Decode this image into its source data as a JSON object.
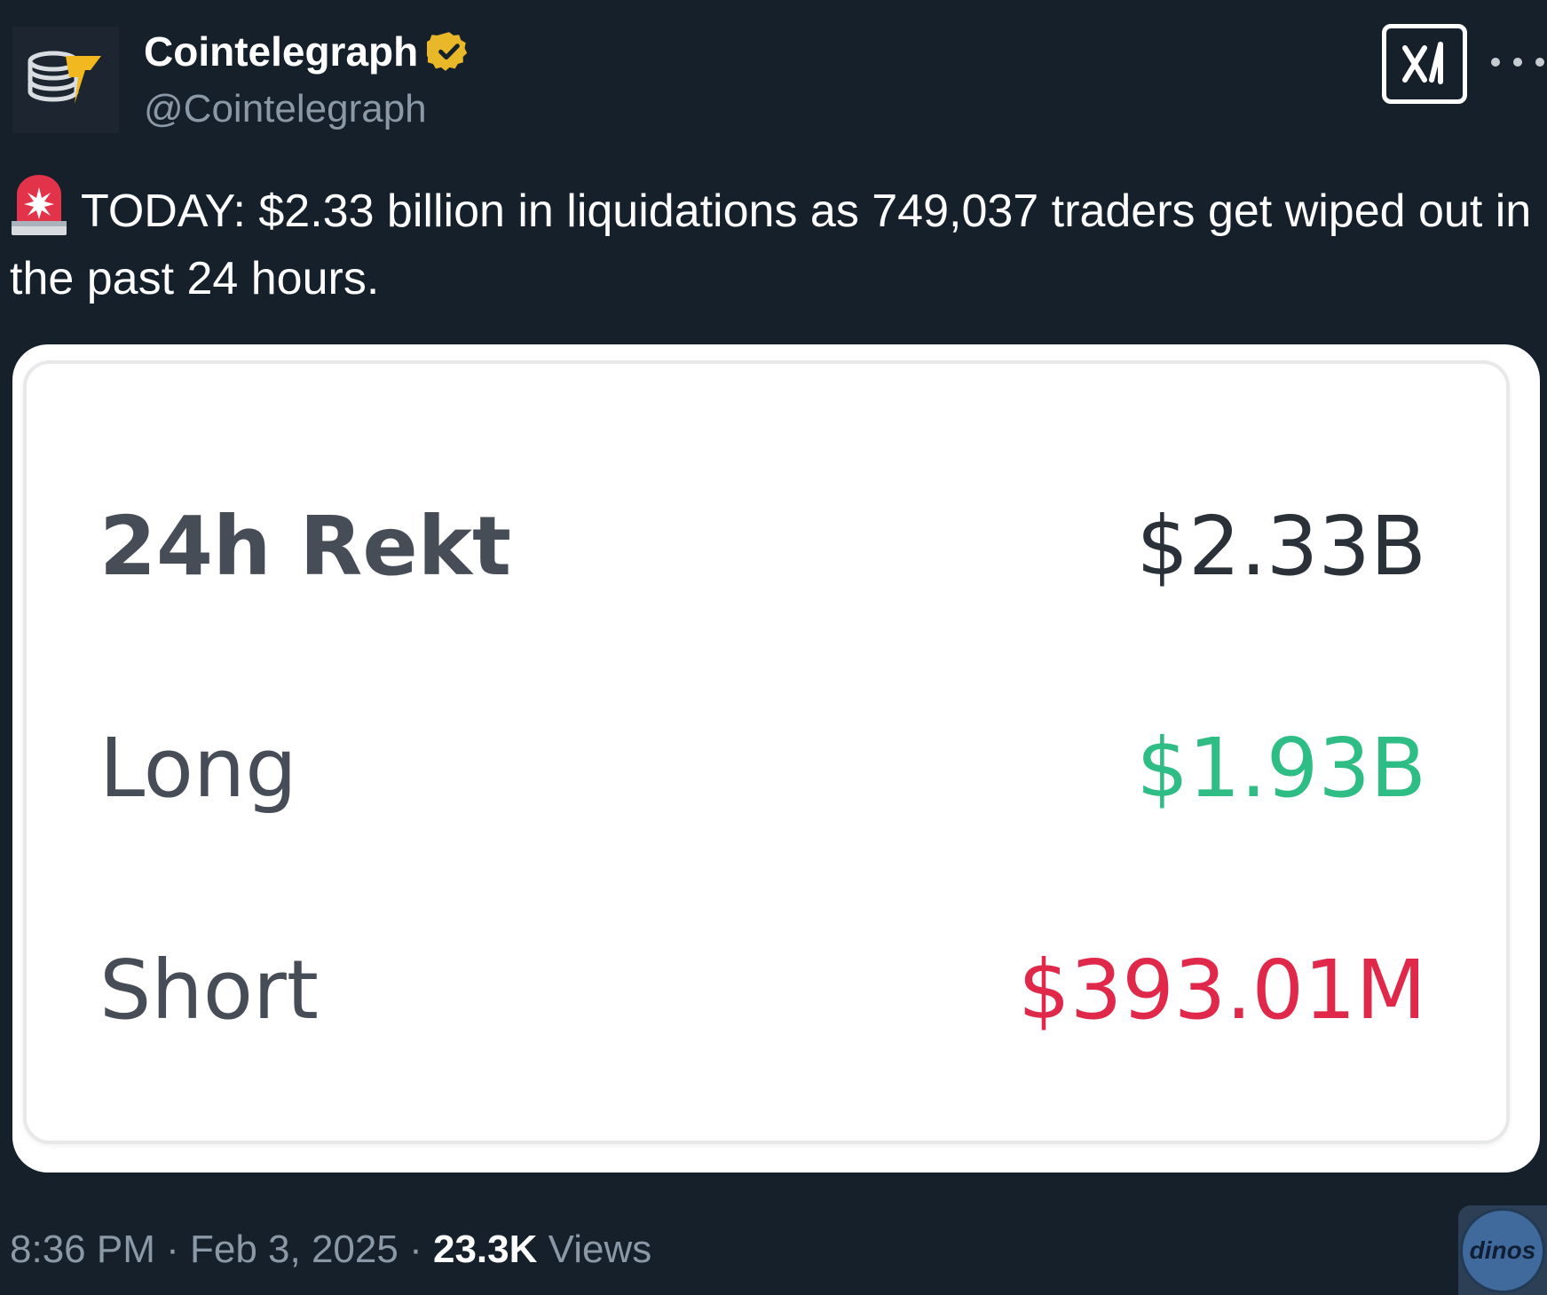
{
  "author": {
    "display_name": "Cointelegraph",
    "handle": "@Cointelegraph",
    "avatar_icon": "coin-stack-lightning-logo",
    "verified_icon": "verified-badge-icon",
    "verified_color": "#e8b829"
  },
  "header_actions": {
    "grok_icon": "grok-icon",
    "more_icon": "more-options-icon"
  },
  "tweet": {
    "emoji_icon": "police-siren-icon",
    "text": "TODAY: $2.33 billion in liquidations as 749,037 traders get wiped out in the past 24 hours."
  },
  "media": {
    "rows": [
      {
        "label": "24h Rekt",
        "value": "$2.33B",
        "color": "#2b3139"
      },
      {
        "label": "Long",
        "value": "$1.93B",
        "color": "#2ebd85"
      },
      {
        "label": "Short",
        "value": "$393.01M",
        "color": "#e0294a"
      }
    ]
  },
  "footer": {
    "time": "8:36 PM",
    "separator": "·",
    "date": "Feb 3, 2025",
    "views_count": "23.3K",
    "views_label": "Views"
  },
  "watermark": {
    "text": "dinos"
  }
}
